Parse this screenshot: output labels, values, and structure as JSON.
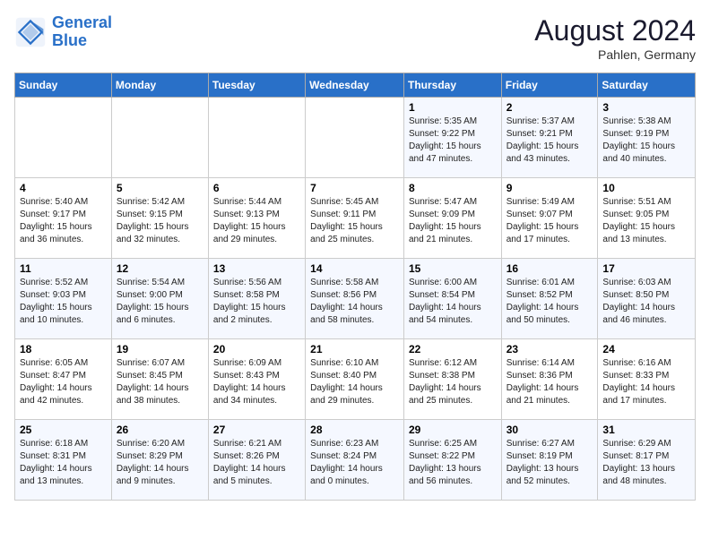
{
  "header": {
    "logo_line1": "General",
    "logo_line2": "Blue",
    "month_year": "August 2024",
    "location": "Pahlen, Germany"
  },
  "weekdays": [
    "Sunday",
    "Monday",
    "Tuesday",
    "Wednesday",
    "Thursday",
    "Friday",
    "Saturday"
  ],
  "weeks": [
    [
      {
        "day": "",
        "info": ""
      },
      {
        "day": "",
        "info": ""
      },
      {
        "day": "",
        "info": ""
      },
      {
        "day": "",
        "info": ""
      },
      {
        "day": "1",
        "info": "Sunrise: 5:35 AM\nSunset: 9:22 PM\nDaylight: 15 hours\nand 47 minutes."
      },
      {
        "day": "2",
        "info": "Sunrise: 5:37 AM\nSunset: 9:21 PM\nDaylight: 15 hours\nand 43 minutes."
      },
      {
        "day": "3",
        "info": "Sunrise: 5:38 AM\nSunset: 9:19 PM\nDaylight: 15 hours\nand 40 minutes."
      }
    ],
    [
      {
        "day": "4",
        "info": "Sunrise: 5:40 AM\nSunset: 9:17 PM\nDaylight: 15 hours\nand 36 minutes."
      },
      {
        "day": "5",
        "info": "Sunrise: 5:42 AM\nSunset: 9:15 PM\nDaylight: 15 hours\nand 32 minutes."
      },
      {
        "day": "6",
        "info": "Sunrise: 5:44 AM\nSunset: 9:13 PM\nDaylight: 15 hours\nand 29 minutes."
      },
      {
        "day": "7",
        "info": "Sunrise: 5:45 AM\nSunset: 9:11 PM\nDaylight: 15 hours\nand 25 minutes."
      },
      {
        "day": "8",
        "info": "Sunrise: 5:47 AM\nSunset: 9:09 PM\nDaylight: 15 hours\nand 21 minutes."
      },
      {
        "day": "9",
        "info": "Sunrise: 5:49 AM\nSunset: 9:07 PM\nDaylight: 15 hours\nand 17 minutes."
      },
      {
        "day": "10",
        "info": "Sunrise: 5:51 AM\nSunset: 9:05 PM\nDaylight: 15 hours\nand 13 minutes."
      }
    ],
    [
      {
        "day": "11",
        "info": "Sunrise: 5:52 AM\nSunset: 9:03 PM\nDaylight: 15 hours\nand 10 minutes."
      },
      {
        "day": "12",
        "info": "Sunrise: 5:54 AM\nSunset: 9:00 PM\nDaylight: 15 hours\nand 6 minutes."
      },
      {
        "day": "13",
        "info": "Sunrise: 5:56 AM\nSunset: 8:58 PM\nDaylight: 15 hours\nand 2 minutes."
      },
      {
        "day": "14",
        "info": "Sunrise: 5:58 AM\nSunset: 8:56 PM\nDaylight: 14 hours\nand 58 minutes."
      },
      {
        "day": "15",
        "info": "Sunrise: 6:00 AM\nSunset: 8:54 PM\nDaylight: 14 hours\nand 54 minutes."
      },
      {
        "day": "16",
        "info": "Sunrise: 6:01 AM\nSunset: 8:52 PM\nDaylight: 14 hours\nand 50 minutes."
      },
      {
        "day": "17",
        "info": "Sunrise: 6:03 AM\nSunset: 8:50 PM\nDaylight: 14 hours\nand 46 minutes."
      }
    ],
    [
      {
        "day": "18",
        "info": "Sunrise: 6:05 AM\nSunset: 8:47 PM\nDaylight: 14 hours\nand 42 minutes."
      },
      {
        "day": "19",
        "info": "Sunrise: 6:07 AM\nSunset: 8:45 PM\nDaylight: 14 hours\nand 38 minutes."
      },
      {
        "day": "20",
        "info": "Sunrise: 6:09 AM\nSunset: 8:43 PM\nDaylight: 14 hours\nand 34 minutes."
      },
      {
        "day": "21",
        "info": "Sunrise: 6:10 AM\nSunset: 8:40 PM\nDaylight: 14 hours\nand 29 minutes."
      },
      {
        "day": "22",
        "info": "Sunrise: 6:12 AM\nSunset: 8:38 PM\nDaylight: 14 hours\nand 25 minutes."
      },
      {
        "day": "23",
        "info": "Sunrise: 6:14 AM\nSunset: 8:36 PM\nDaylight: 14 hours\nand 21 minutes."
      },
      {
        "day": "24",
        "info": "Sunrise: 6:16 AM\nSunset: 8:33 PM\nDaylight: 14 hours\nand 17 minutes."
      }
    ],
    [
      {
        "day": "25",
        "info": "Sunrise: 6:18 AM\nSunset: 8:31 PM\nDaylight: 14 hours\nand 13 minutes."
      },
      {
        "day": "26",
        "info": "Sunrise: 6:20 AM\nSunset: 8:29 PM\nDaylight: 14 hours\nand 9 minutes."
      },
      {
        "day": "27",
        "info": "Sunrise: 6:21 AM\nSunset: 8:26 PM\nDaylight: 14 hours\nand 5 minutes."
      },
      {
        "day": "28",
        "info": "Sunrise: 6:23 AM\nSunset: 8:24 PM\nDaylight: 14 hours\nand 0 minutes."
      },
      {
        "day": "29",
        "info": "Sunrise: 6:25 AM\nSunset: 8:22 PM\nDaylight: 13 hours\nand 56 minutes."
      },
      {
        "day": "30",
        "info": "Sunrise: 6:27 AM\nSunset: 8:19 PM\nDaylight: 13 hours\nand 52 minutes."
      },
      {
        "day": "31",
        "info": "Sunrise: 6:29 AM\nSunset: 8:17 PM\nDaylight: 13 hours\nand 48 minutes."
      }
    ]
  ]
}
